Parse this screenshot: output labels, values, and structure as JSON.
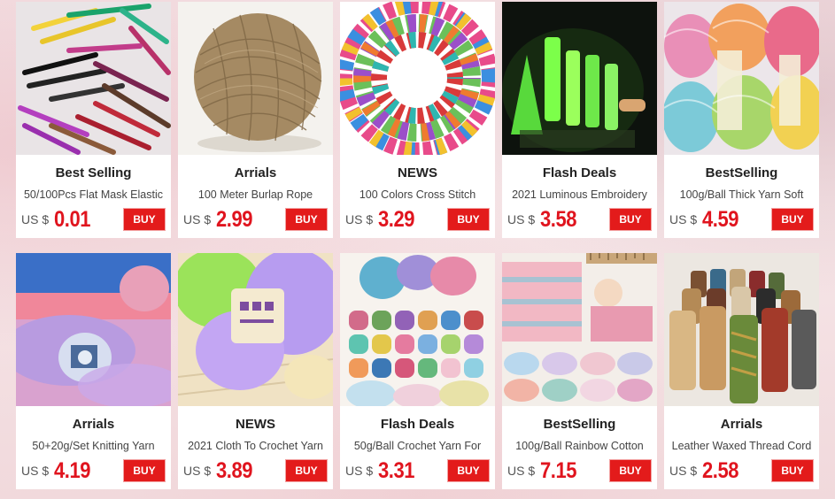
{
  "currency_label": "US $",
  "buy_label": "BUY",
  "products": [
    {
      "badge": "Best Selling",
      "title": "50/100Pcs Flat Mask Elastic",
      "price": "0.01",
      "image": "elastic-bands-image"
    },
    {
      "badge": "Arrials",
      "title": "100 Meter Burlap Rope",
      "price": "2.99",
      "image": "jute-twine-ball-image"
    },
    {
      "badge": "NEWS",
      "title": "100 Colors Cross Stitch",
      "price": "3.29",
      "image": "embroidery-thread-wheel-image"
    },
    {
      "badge": "Flash Deals",
      "title": "2021 Luminous Embroidery",
      "price": "3.58",
      "image": "glowing-thread-spools-image"
    },
    {
      "badge": "BestSelling",
      "title": "100g/Ball Thick Yarn Soft",
      "price": "4.59",
      "image": "yarn-balls-image"
    },
    {
      "badge": "Arrials",
      "title": "50+20g/Set Knitting Yarn",
      "price": "4.19",
      "image": "mohair-yarn-image"
    },
    {
      "badge": "NEWS",
      "title": "2021 Cloth To Crochet Yarn",
      "price": "3.89",
      "image": "purple-yarn-balls-image"
    },
    {
      "badge": "Flash Deals",
      "title": "50g/Ball Crochet Yarn For",
      "price": "3.31",
      "image": "milk-cotton-yarn-image"
    },
    {
      "badge": "BestSelling",
      "title": "100g/Ball Rainbow Cotton",
      "price": "7.15",
      "image": "rainbow-cotton-yarn-image"
    },
    {
      "badge": "Arrials",
      "title": "Leather Waxed Thread Cord",
      "price": "2.58",
      "image": "waxed-thread-spools-image"
    }
  ],
  "colors": {
    "price_red": "#e0141e",
    "buy_red": "#e31b1b",
    "background": "#f3dfe2"
  }
}
